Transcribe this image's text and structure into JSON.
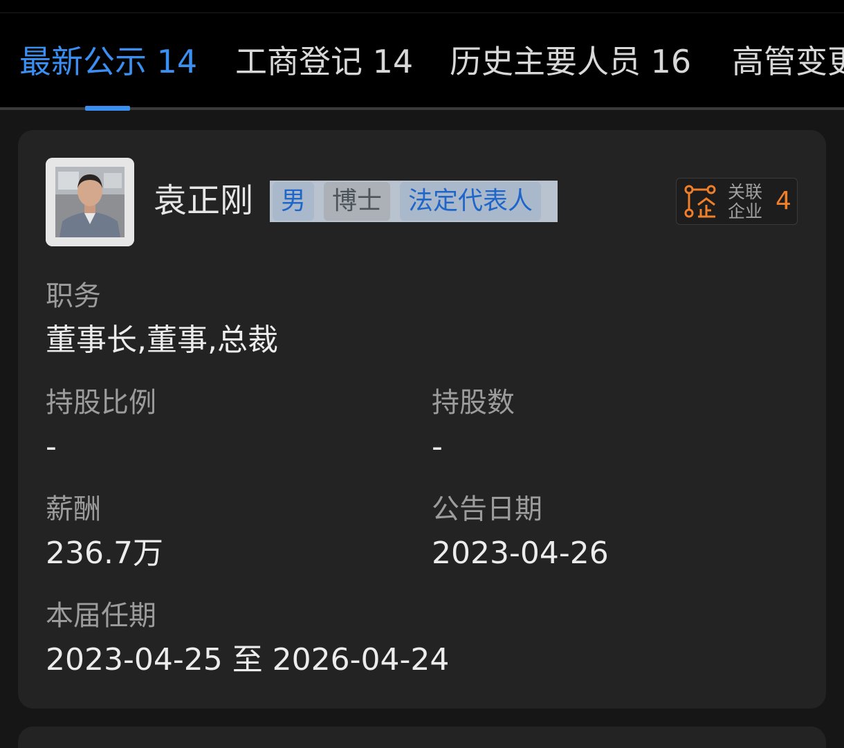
{
  "tabs": [
    {
      "label": "最新公示 14",
      "active": true
    },
    {
      "label": "工商登记 14",
      "active": false
    },
    {
      "label": "历史主要人员 16",
      "active": false
    },
    {
      "label": "高管变更",
      "active": false
    }
  ],
  "person": {
    "name": "袁正刚",
    "tags": [
      "男",
      "博士",
      "法定代表人"
    ],
    "related": {
      "label": "关联企业",
      "count": "4"
    }
  },
  "fields": {
    "position_label": "职务",
    "position_value": "董事长,董事,总裁",
    "share_ratio_label": "持股比例",
    "share_ratio_value": "-",
    "share_count_label": "持股数",
    "share_count_value": "-",
    "salary_label": "薪酬",
    "salary_value": "236.7万",
    "announce_date_label": "公告日期",
    "announce_date_value": "2023-04-26",
    "term_label": "本届任期",
    "term_value": "2023-04-25 至 2026-04-24"
  },
  "colors": {
    "accent": "#3a8ff0",
    "related_count": "#f07f2a",
    "card_bg": "#232323",
    "page_bg": "#161616"
  }
}
